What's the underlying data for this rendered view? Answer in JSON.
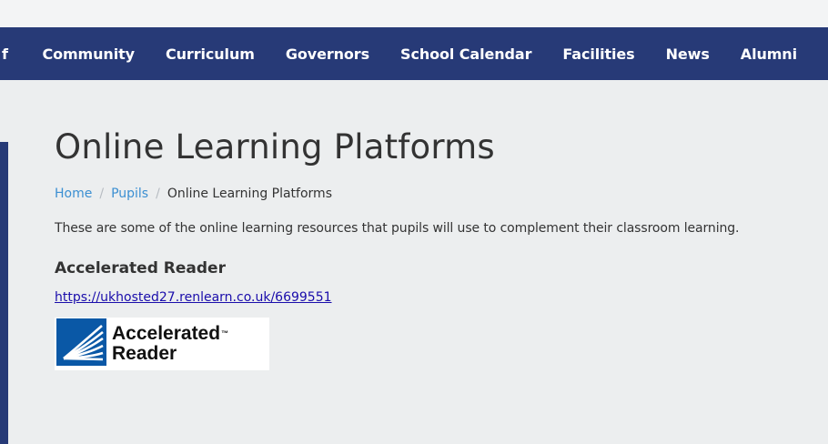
{
  "nav": {
    "fragment": "f",
    "items": [
      "Community",
      "Curriculum",
      "Governors",
      "School Calendar",
      "Facilities",
      "News",
      "Alumni"
    ]
  },
  "page": {
    "title": "Online Learning Platforms",
    "breadcrumb": {
      "home": "Home",
      "pupils": "Pupils",
      "separator": "/",
      "current": "Online Learning Platforms"
    },
    "intro": "These are some of the online learning resources that pupils will use to complement their classroom learning.",
    "sections": [
      {
        "heading": "Accelerated Reader",
        "link": "https://ukhosted27.renlearn.co.uk/6699551",
        "logo": {
          "line1": "Accelerated",
          "line2": "Reader",
          "tm": "™",
          "icon": "renlearn-book-icon"
        }
      }
    ]
  },
  "colors": {
    "nav_bg": "#273a77",
    "page_bg": "#eceeef",
    "breadcrumb_link": "#3b8fd2",
    "resource_link": "#1a0dab",
    "logo_blue": "#0a58a6"
  }
}
